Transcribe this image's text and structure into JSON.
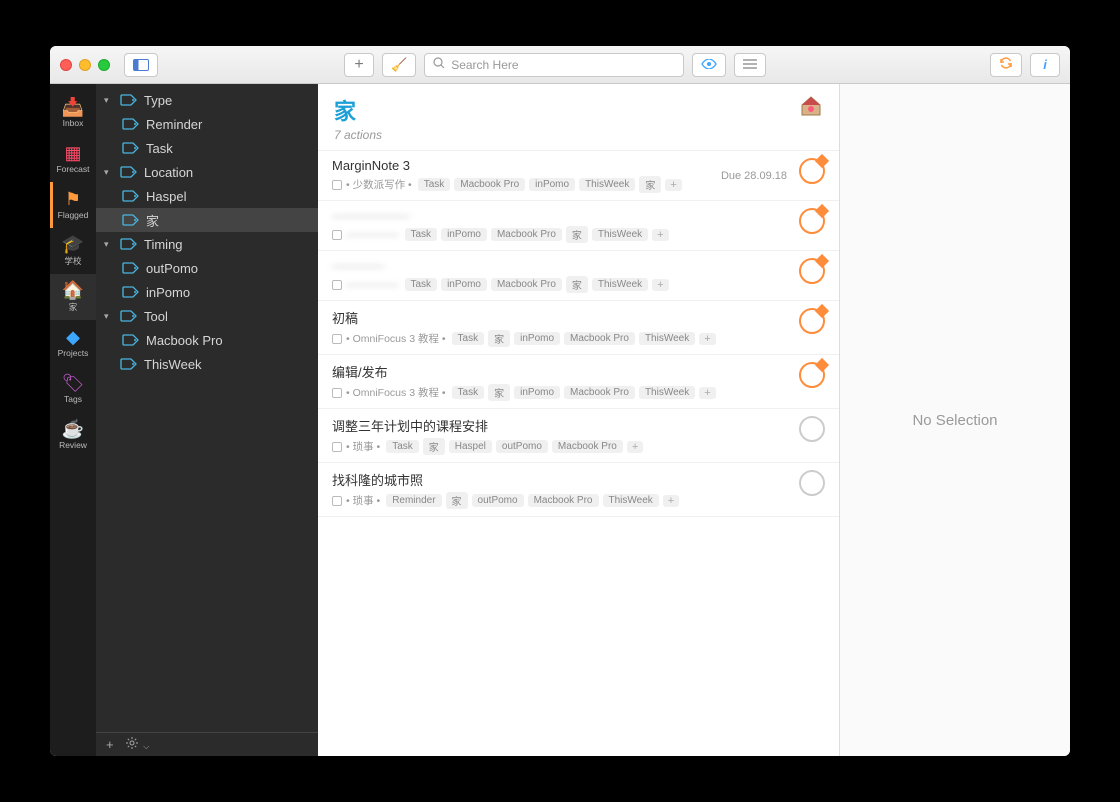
{
  "toolbar": {
    "search_placeholder": "Search Here",
    "add_label": "+"
  },
  "perspectives": [
    {
      "key": "inbox",
      "label": "Inbox",
      "icon": "📥",
      "color": "#5e8cff"
    },
    {
      "key": "forecast",
      "label": "Forecast",
      "icon": "▦",
      "color": "#ff4d6a"
    },
    {
      "key": "flagged",
      "label": "Flagged",
      "icon": "⚑",
      "color": "#ff9a3c",
      "highlight": true
    },
    {
      "key": "school",
      "label": "学校",
      "icon": "🎓",
      "color": "#cfa060"
    },
    {
      "key": "home",
      "label": "家",
      "icon": "🏠",
      "color": "#ff7a7a",
      "active": true
    },
    {
      "key": "projects",
      "label": "Projects",
      "icon": "◆",
      "color": "#3da7ff"
    },
    {
      "key": "tags",
      "label": "Tags",
      "icon": "🏷",
      "color": "#c65dd1"
    },
    {
      "key": "review",
      "label": "Review",
      "icon": "☕",
      "color": "#7aa7ff"
    }
  ],
  "sidebar": {
    "groups": [
      {
        "label": "Type",
        "children": [
          "Reminder",
          "Task"
        ]
      },
      {
        "label": "Location",
        "children": [
          "Haspel",
          "家"
        ]
      },
      {
        "label": "Timing",
        "children": [
          "outPomo",
          "inPomo"
        ]
      },
      {
        "label": "Tool",
        "children": [
          "Macbook Pro"
        ]
      }
    ],
    "loose": [
      "ThisWeek"
    ],
    "selected": "家",
    "footer_add": "+",
    "footer_gear": "⚙"
  },
  "main": {
    "title": "家",
    "subtitle": "7 actions",
    "house_icon": "🏠"
  },
  "actions": [
    {
      "title": "MarginNote 3",
      "project": "• 少数派写作 •",
      "tags": [
        "Task",
        "Macbook Pro",
        "inPomo",
        "ThisWeek",
        "家"
      ],
      "due": "Due 28.09.18",
      "flagged": true
    },
    {
      "title": "——————",
      "blurred": true,
      "project": "—————",
      "project_blurred": true,
      "tags": [
        "Task",
        "inPomo",
        "Macbook Pro",
        "家",
        "ThisWeek"
      ],
      "flagged": true
    },
    {
      "title": "————",
      "blurred": true,
      "project": "—————",
      "project_blurred": true,
      "tags": [
        "Task",
        "inPomo",
        "Macbook Pro",
        "家",
        "ThisWeek"
      ],
      "flagged": true
    },
    {
      "title": "初稿",
      "project": "• OmniFocus 3 教程 •",
      "tags": [
        "Task",
        "家",
        "inPomo",
        "Macbook Pro",
        "ThisWeek"
      ],
      "flagged": true
    },
    {
      "title": "编辑/发布",
      "project": "• OmniFocus 3 教程 •",
      "tags": [
        "Task",
        "家",
        "inPomo",
        "Macbook Pro",
        "ThisWeek"
      ],
      "flagged": true
    },
    {
      "title": "调整三年计划中的课程安排",
      "project": "• 琐事 •",
      "tags": [
        "Task",
        "家",
        "Haspel",
        "outPomo",
        "Macbook Pro"
      ],
      "flagged": false
    },
    {
      "title": "找科隆的城市照",
      "project": "• 琐事 •",
      "tags": [
        "Reminder",
        "家",
        "outPomo",
        "Macbook Pro",
        "ThisWeek"
      ],
      "flagged": false
    }
  ],
  "inspector": {
    "empty_label": "No Selection"
  },
  "colors": {
    "accent": "#1a9fd6",
    "flag": "#ff8c3a"
  }
}
